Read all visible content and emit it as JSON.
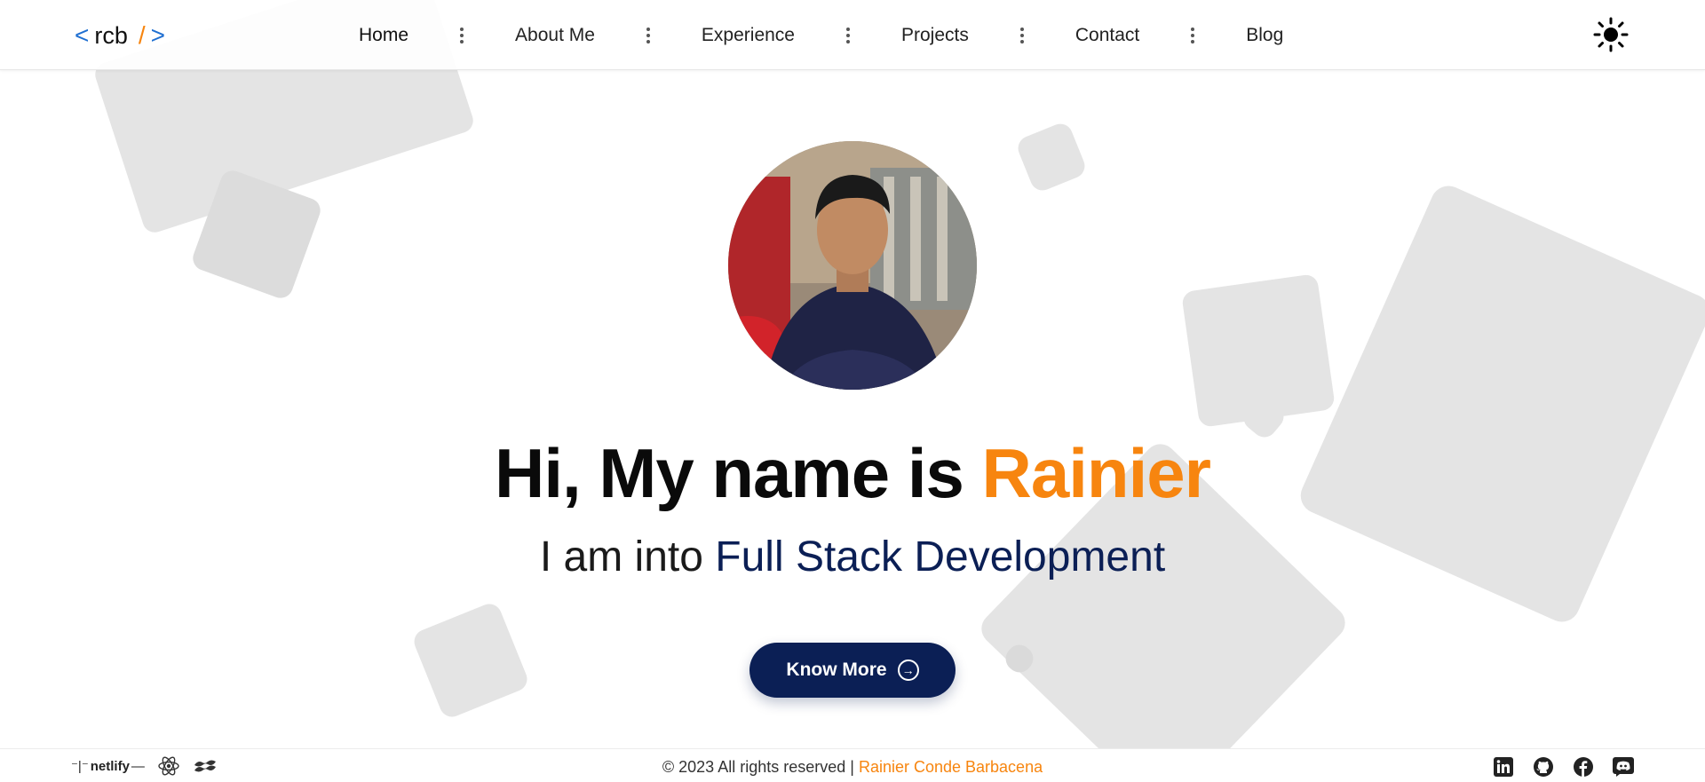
{
  "header": {
    "logo": {
      "open": "<",
      "text": "rcb",
      "slash": "/",
      "close": ">"
    },
    "nav": [
      {
        "label": "Home"
      },
      {
        "label": "About Me"
      },
      {
        "label": "Experience"
      },
      {
        "label": "Projects"
      },
      {
        "label": "Contact"
      },
      {
        "label": "Blog"
      }
    ],
    "theme_icon": "sun-icon"
  },
  "hero": {
    "title_prefix": "Hi, My name is",
    "title_name": "Rainier",
    "subtitle_prefix": "I am into",
    "subtitle_role": "Full Stack Development",
    "cta_label": "Know More"
  },
  "footer": {
    "built_with": [
      {
        "name": "netlify",
        "icon": "netlify-icon"
      },
      {
        "icon": "react-icon"
      },
      {
        "icon": "tailwind-icon"
      }
    ],
    "copyright_prefix": "© 2023 All rights reserved |",
    "copyright_owner": "Rainier Conde Barbacena",
    "socials": [
      {
        "icon": "linkedin-icon"
      },
      {
        "icon": "github-icon"
      },
      {
        "icon": "facebook-icon"
      },
      {
        "icon": "discord-icon"
      }
    ]
  },
  "colors": {
    "accent": "#f7850f",
    "primary": "#0b1f55",
    "logo_bracket": "#1f6fd1",
    "shape": "#e4e4e4"
  }
}
